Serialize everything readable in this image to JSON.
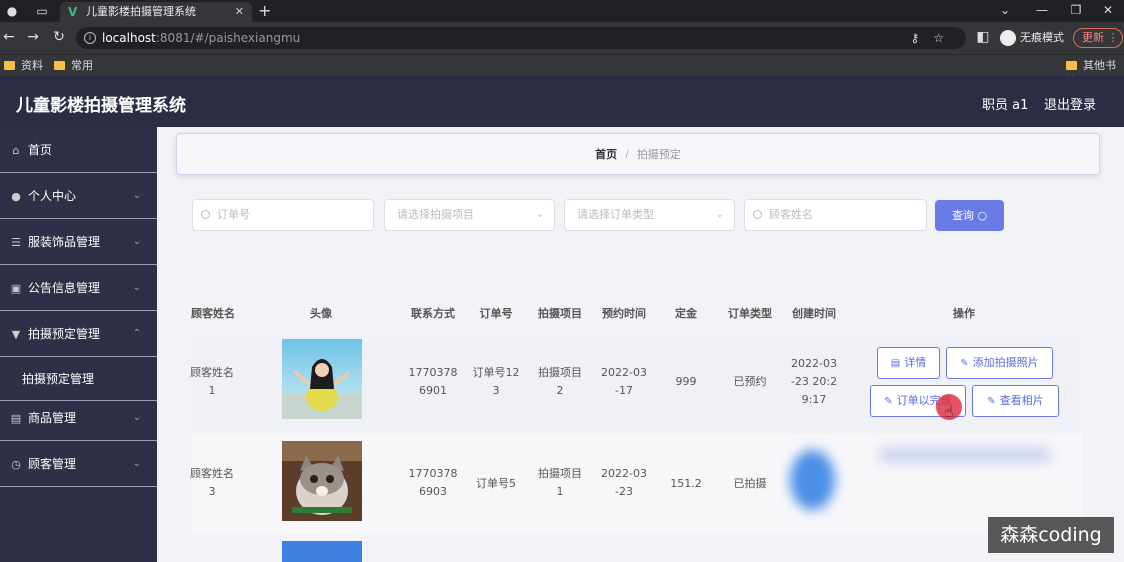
{
  "browser": {
    "tab_title": "儿童影楼拍摄管理系统",
    "url_host": "localhost",
    "url_path": ":8081/#/paishexiangmu",
    "incognito_label": "无痕模式",
    "update_label": "更新",
    "bookmarks": [
      "资料",
      "常用"
    ],
    "other_bookmarks": "其他书签"
  },
  "header": {
    "title": "儿童影楼拍摄管理系统",
    "user": "职员 a1",
    "logout": "退出登录"
  },
  "sidebar": {
    "items": [
      {
        "label": "首页",
        "icon": "home-icon"
      },
      {
        "label": "个人中心",
        "icon": "user-icon"
      },
      {
        "label": "服装饰品管理",
        "icon": "list-icon"
      },
      {
        "label": "公告信息管理",
        "icon": "briefcase-icon"
      },
      {
        "label": "拍摄预定管理",
        "icon": "cup-icon"
      },
      {
        "label": "拍摄预定管理",
        "sub": true
      },
      {
        "label": "商品管理",
        "icon": "goods-icon"
      },
      {
        "label": "顾客管理",
        "icon": "clock-icon"
      }
    ]
  },
  "breadcrumb": {
    "home": "首页",
    "current": "拍摄预定"
  },
  "search": {
    "order_placeholder": "订单号",
    "project_placeholder": "请选择拍摄项目",
    "type_placeholder": "请选择订单类型",
    "customer_placeholder": "顾客姓名",
    "query_label": "查询"
  },
  "table": {
    "headers": [
      "顾客姓名",
      "头像",
      "联系方式",
      "订单号",
      "拍摄项目",
      "预约时间",
      "定金",
      "订单类型",
      "创建时间",
      "操作"
    ],
    "rows": [
      {
        "name": [
          "顾客姓名",
          "1"
        ],
        "phone": [
          "1770378",
          "6901"
        ],
        "order": [
          "订单号12",
          "3"
        ],
        "project": [
          "拍摄项目",
          "2"
        ],
        "date": [
          "2022-03",
          "-17"
        ],
        "deposit": "999",
        "type": "已预约",
        "created": [
          "2022-03",
          "-23 20:2",
          "9:17"
        ]
      },
      {
        "name": [
          "顾客姓名",
          "3"
        ],
        "phone": [
          "1770378",
          "6903"
        ],
        "order": [
          "订单号5"
        ],
        "project": [
          "拍摄项目",
          "1"
        ],
        "date": [
          "2022-03",
          "-23"
        ],
        "deposit": "151.2",
        "type": "已拍摄"
      }
    ],
    "actions": {
      "detail": "详情",
      "add_photo": "添加拍摄照片",
      "complete": "订单以完成",
      "view_album": "查看相片"
    }
  },
  "watermark": "森森coding",
  "colors": {
    "header_bg": "#2b2d44",
    "sidebar_bg": "#2e3047",
    "accent": "#6a7be8"
  }
}
